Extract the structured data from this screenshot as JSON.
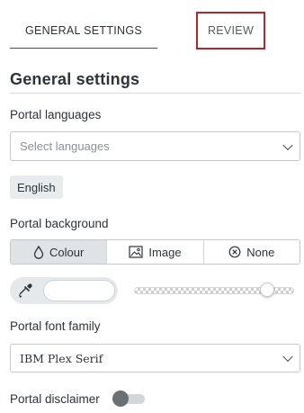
{
  "tabs": {
    "general_label": "GENERAL SETTINGS",
    "review_label": "REVIEW"
  },
  "section": {
    "title": "General settings"
  },
  "languages": {
    "label": "Portal languages",
    "placeholder": "Select languages",
    "selected_chip": "English"
  },
  "background": {
    "label": "Portal background",
    "options": [
      {
        "label": "Colour",
        "icon": "droplet-icon",
        "active": true
      },
      {
        "label": "Image",
        "icon": "image-icon",
        "active": false
      },
      {
        "label": "None",
        "icon": "circle-x-icon",
        "active": false
      }
    ],
    "color_value": "",
    "opacity_fraction": 0.9
  },
  "font": {
    "label": "Portal font family",
    "value": "IBM Plex Serif"
  },
  "disclaimer": {
    "label": "Portal disclaimer",
    "enabled": false
  },
  "colors": {
    "review_tab_border": "#b3262b",
    "active_option_bg": "#dfe3e6",
    "chip_bg": "#e9ecee"
  }
}
